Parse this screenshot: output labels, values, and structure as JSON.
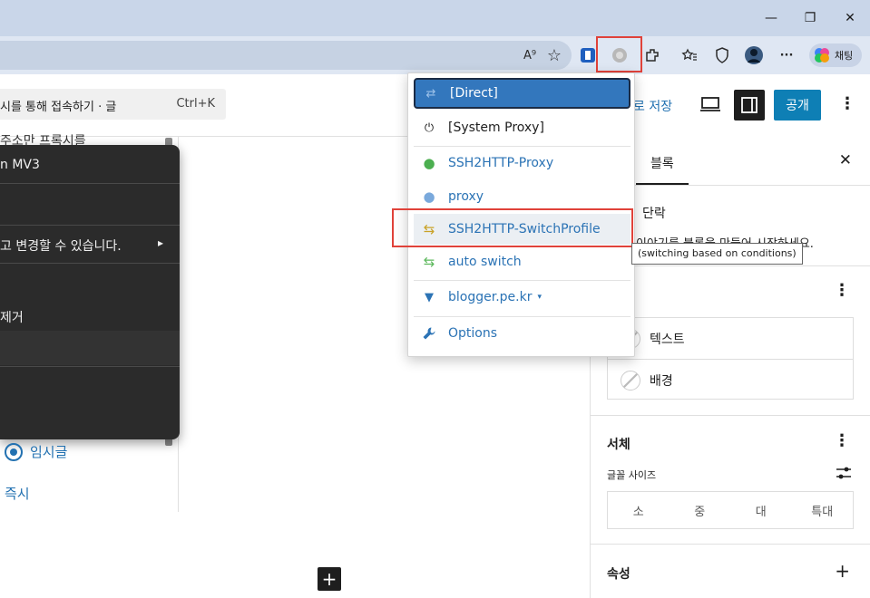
{
  "browser": {
    "window_controls": {
      "minimize": "—",
      "maximize": "❐",
      "close": "✕"
    },
    "toolbar": {
      "read_aloud": "A⁹",
      "favorite": "☆",
      "copilot_label": "채팅",
      "more": "···"
    }
  },
  "left": {
    "command_text": "시를 통해 접속하기 · 글",
    "command_shortcut": "Ctrl+K",
    "behind_text": "주소만 프록시를",
    "context_menu": {
      "items": [
        {
          "label": "n MV3"
        },
        {
          "label": "고 변경할 수 있습니다."
        },
        {
          "label": "제거"
        }
      ],
      "arrow": "▸"
    },
    "draft_label": "임시글",
    "now_label": "즉시",
    "add_block": "+"
  },
  "editor_header": {
    "save_label": "로 저장",
    "publish_label": "공개",
    "more": "⋮"
  },
  "sidebar": {
    "tab_block": "블록",
    "close": "✕",
    "block_title": "단락",
    "block_desc": "이야기를 블록을 만들어 시작하세요.",
    "color_items": [
      {
        "label": "텍스트"
      },
      {
        "label": "배경"
      }
    ],
    "typography_title": "서체",
    "font_size_label": "글꼴 사이즈",
    "font_sizes": [
      "소",
      "중",
      "대",
      "특대"
    ],
    "attributes_title": "속성",
    "add": "+",
    "more": "⋮"
  },
  "proxy_popup": {
    "items": [
      {
        "label": "[Direct]",
        "icon": "transfer-arrows-icon",
        "glyph": "⇄",
        "color": "#ffffff"
      },
      {
        "label": "[System Proxy]",
        "icon": "power-icon",
        "glyph": "⏻",
        "color": "#1e1e1e"
      },
      {
        "label": "SSH2HTTP-Proxy",
        "icon": "globe-icon",
        "glyph": "●",
        "color": "#4caf50"
      },
      {
        "label": "proxy",
        "icon": "globe-icon",
        "glyph": "●",
        "color": "#7aa9dc"
      },
      {
        "label": "SSH2HTTP-SwitchProfile",
        "icon": "switch-icon",
        "glyph": "⇆",
        "color": "#c9a227"
      },
      {
        "label": "auto switch",
        "icon": "switch-icon",
        "glyph": "⇆",
        "color": "#5cb85c"
      },
      {
        "label": "blogger.pe.kr",
        "icon": "filter-icon",
        "glyph": "▼",
        "color": "#2b73b5"
      },
      {
        "label": "Options",
        "icon": "wrench-icon",
        "glyph": "🔧",
        "color": "#2b73b5"
      }
    ],
    "dropdown_caret": "▾",
    "tooltip": "(switching based on conditions)"
  },
  "colors": {
    "accent": "#2271b1",
    "publish": "#0e7fb5",
    "active_item": "#3377bd",
    "highlight_box": "#e0423a"
  }
}
